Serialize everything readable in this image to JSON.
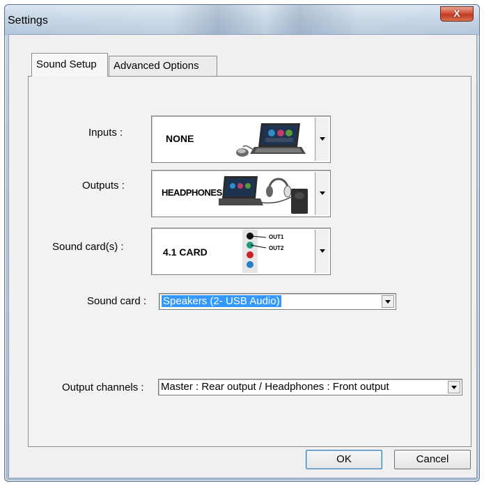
{
  "window": {
    "title": "Settings",
    "close_glyph": "X"
  },
  "tabs": [
    {
      "label": "Sound Setup",
      "active": true
    },
    {
      "label": "Advanced Options",
      "active": false
    }
  ],
  "inputs": {
    "label": "Inputs :",
    "value": "NONE",
    "icon": "laptop-mouse-icon"
  },
  "outputs": {
    "label": "Outputs :",
    "value": "HEADPHONES",
    "icon": "laptop-headphones-speaker-icon"
  },
  "soundcards": {
    "label": "Sound card(s) :",
    "value": "4.1 CARD",
    "out1": "OUT1",
    "out2": "OUT2",
    "icon": "jacks-icon"
  },
  "soundcard": {
    "label": "Sound card :",
    "value": "Speakers (2- USB Audio)"
  },
  "output_channels": {
    "label": "Output channels :",
    "value": "Master : Rear output  / Headphones : Front output"
  },
  "buttons": {
    "ok": "OK",
    "cancel": "Cancel"
  },
  "colors": {
    "selection": "#3399ff",
    "close": "#c8452d"
  }
}
